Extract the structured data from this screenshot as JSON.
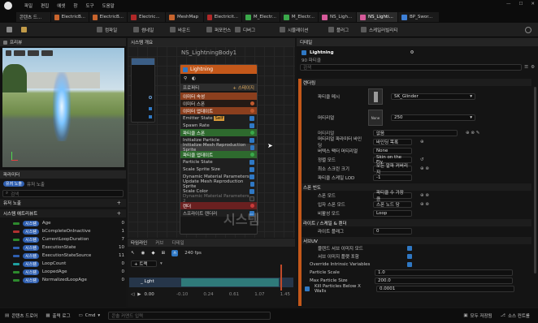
{
  "menu": [
    "파일",
    "편집",
    "에셋",
    "창",
    "도구",
    "도움말"
  ],
  "tabs": [
    "콘텐츠 드...",
    "ElectricB...",
    "ElectricB...",
    "Electric...",
    "MeshMap",
    "Electricit...",
    "M_Electr...",
    "M_Electr...",
    "NS_Ligh...",
    "NS_Lighti...",
    "BP_Swor..."
  ],
  "toolbar": {
    "save": "",
    "compile": "컴파일",
    "thumbnail": "썸네일",
    "bounds": "바운드",
    "debug": "디버그",
    "sim": "시뮬레이션",
    "perf": "퍼포먼스",
    "baker": "플러그",
    "scal": "스케일러빌리티"
  },
  "viewport": {
    "title": "프리뷰"
  },
  "graph": {
    "title": "시스템 개요",
    "system_name": "NS_LightningBody1",
    "emitter_name": "Lightning",
    "emitter_spawn_label": "이미터 스폰",
    "emitter_update_label": "이미터 업데이트",
    "emitter_state": "Emitter State",
    "emitter_state_tag": "Self",
    "spawn_rate": "Spawn Rate",
    "particle_spawn_label": "파티클 스폰",
    "init_particle": "Initialize Particle",
    "init_mesh_rep": "Initialize Mesh Reproduction Sprite",
    "particle_update_label": "파티클 업데이트",
    "particle_state": "Particle State",
    "scale_sprite": "Scale Sprite Size",
    "dyn_mat": "Dynamic Material Parameters",
    "update_mesh_rep": "Update Mesh Reproduction Sprite",
    "scale_color": "Scale Color",
    "dyn_mat2": "Dynamic Material Parameters 2",
    "render_label": "렌더",
    "sprite_renderer": "스프라이트 렌더러",
    "properties_label": "프로퍼티",
    "top_label": "이미터 속성",
    "add_label": "+ 스테이지",
    "watermark": "시스템"
  },
  "params": {
    "title": "파라미터",
    "search_placeholder": "검색",
    "tab_all": "유저 노출",
    "tab_user": "유저 노출",
    "section_user": "유저 노출",
    "section_sys": "시스템 애트리뷰트",
    "rows": [
      {
        "tag": "시스템",
        "name": "Age",
        "val": "0"
      },
      {
        "tag": "시스템",
        "name": "bCompleteOnInactive",
        "val": "1"
      },
      {
        "tag": "시스템",
        "name": "CurrentLoopDuration",
        "val": "7"
      },
      {
        "tag": "시스템",
        "name": "ExecutionState",
        "val": "10"
      },
      {
        "tag": "시스템",
        "name": "ExecutionStateSource",
        "val": "11"
      },
      {
        "tag": "시스템",
        "name": "LoopCount",
        "val": "0"
      },
      {
        "tag": "시스템",
        "name": "LoopedAge",
        "val": "0"
      },
      {
        "tag": "시스템",
        "name": "NormalizedLoopAge",
        "val": "0"
      }
    ]
  },
  "timeline": {
    "title": "타임라인",
    "curves": "커브",
    "viewport_tab": "디테일",
    "add": "+ 트랙",
    "fps": "240 fps",
    "track": "_ Lght",
    "ticks": [
      "-0.10",
      "0.24",
      "0.61",
      "1.07",
      "1.45"
    ],
    "time_start": "0.00"
  },
  "details": {
    "title": "디테일",
    "asset": "Lightning",
    "subtitle": "90 파티클",
    "search_placeholder": "검색",
    "section": "렌더링",
    "mesh_label": "파티클 메시",
    "mesh_value": "SK_Glinder",
    "material_label": "머티리얼",
    "material_value": "None",
    "mat_value2": "250",
    "sub_rows": [
      {
        "label": "머티리얼",
        "value": "없음"
      },
      {
        "label": "머티리얼 파라미터 바인딩",
        "value": "바인딩 목록"
      },
      {
        "label": "버텍스 팩터 머티리얼",
        "value": "None"
      },
      {
        "label": "정렬 모드",
        "value": "Skin on the Fly"
      },
      {
        "label": "최소 스크린 크기",
        "value": "모든 알파 커버리지"
      },
      {
        "label": "파티클 스케일 LOD",
        "value": "-1"
      }
    ],
    "section2": "스폰 빈도",
    "sub_rows2": [
      {
        "label": "스폰 모드",
        "value": "파티클 수 가장 큼"
      },
      {
        "label": "입자 스폰 모드",
        "value": "스폰 노드 당"
      },
      {
        "label": "비활성 모드",
        "value": "Loop"
      }
    ],
    "section3": "라이트 / 스케일 & 렌더",
    "light_label": "라이트 플래그",
    "light_val": "0",
    "section4": "서브UV",
    "sub_rows4": [
      {
        "label": "블렌드 서브 이미지 모드",
        "value": ""
      },
      {
        "label": "서브 이미지 플랫 포함",
        "value": ""
      },
      {
        "label": "Override Intrinsic Variables",
        "value": ""
      },
      {
        "label": "Particle Scale",
        "value": "1.0"
      },
      {
        "label": "Max Particle Size",
        "value": "200.0"
      },
      {
        "label": "Kill Particles Below X Walls",
        "value": "0.0001"
      }
    ]
  },
  "status": {
    "content_drawer": "콘텐츠 드로어",
    "output_log": "출력 로그",
    "cmd": "Cmd",
    "cmd_placeholder": "콘솔 커맨드 입력",
    "unsaved": "모두 저장됨",
    "source": "소스 컨트롤"
  }
}
